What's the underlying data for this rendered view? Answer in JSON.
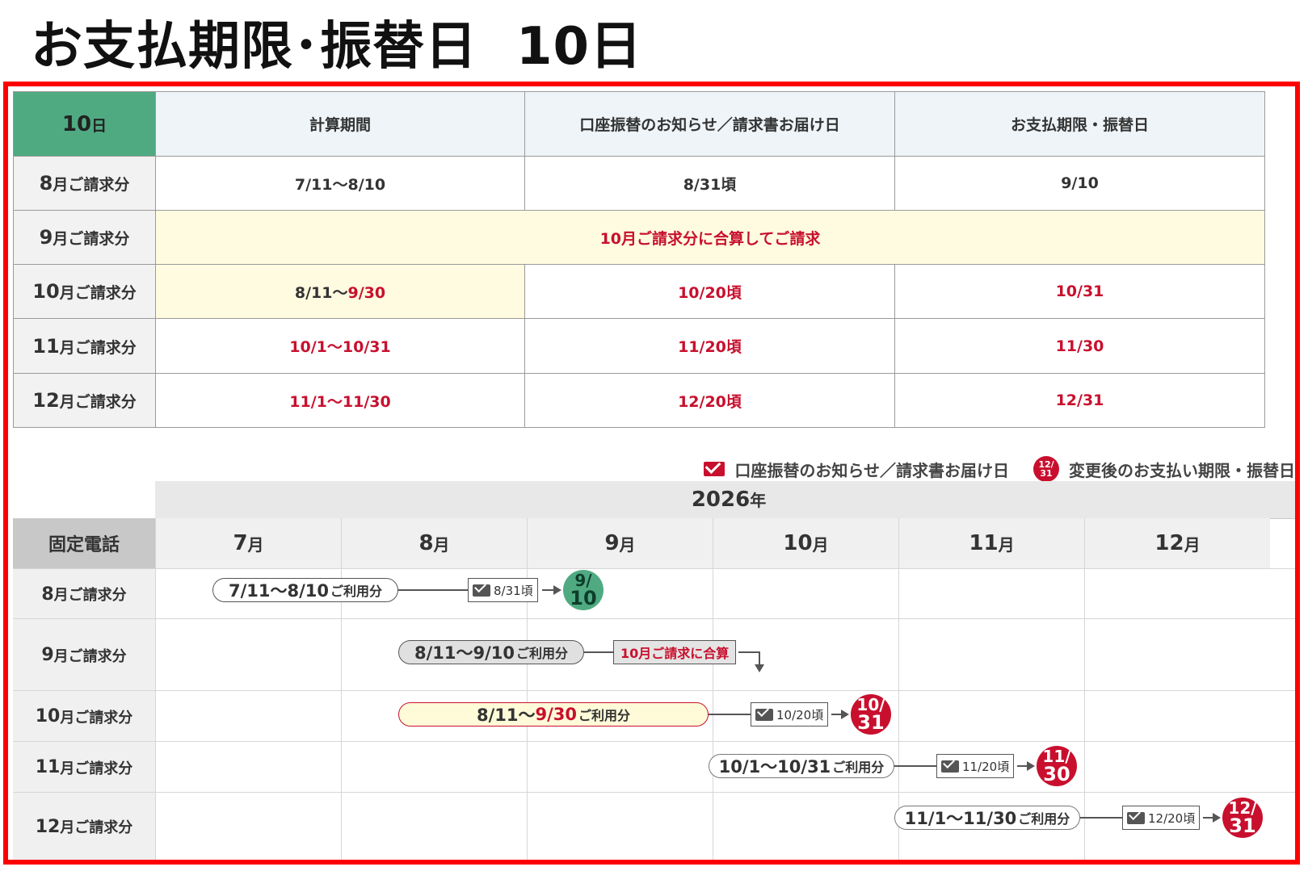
{
  "title": {
    "main": "お支払期限･振替日",
    "sub": "10日"
  },
  "table": {
    "corner": {
      "num": "10",
      "unit": "日"
    },
    "headers": [
      "計算期間",
      "口座振替のお知らせ／請求書お届け日",
      "お支払期限・振替日"
    ],
    "rows": [
      {
        "label_num": "8",
        "label_unit": "月ご請求分",
        "period": "7/11～8/10",
        "notice": "8/31頃",
        "due": "9/10"
      },
      {
        "label_num": "9",
        "label_unit": "月ご請求分",
        "merged": "10月ご請求分に合算してご請求"
      },
      {
        "label_num": "10",
        "label_unit": "月ご請求分",
        "period_a": "8/11～",
        "period_b": "9/30",
        "notice": "10/20頃",
        "due": "10/31"
      },
      {
        "label_num": "11",
        "label_unit": "月ご請求分",
        "period": "10/1～10/31",
        "notice": "11/20頃",
        "due": "11/30"
      },
      {
        "label_num": "12",
        "label_unit": "月ご請求分",
        "period": "11/1～11/30",
        "notice": "12/20頃",
        "due": "12/31"
      }
    ]
  },
  "legend": {
    "notice": "口座振替のお知らせ／請求書お届け日",
    "badge_top": "12/",
    "badge_bot": "31",
    "due": "変更後のお支払い期限・振替日"
  },
  "gantt": {
    "year_num": "2026",
    "year_unit": "年",
    "corner": "固定電話",
    "months": [
      {
        "num": "7",
        "unit": "月"
      },
      {
        "num": "8",
        "unit": "月"
      },
      {
        "num": "9",
        "unit": "月"
      },
      {
        "num": "10",
        "unit": "月"
      },
      {
        "num": "11",
        "unit": "月"
      },
      {
        "num": "12",
        "unit": "月"
      }
    ],
    "usage_suffix": "ご利用分",
    "rows": [
      {
        "label_num": "8",
        "label_unit": "月ご請求分",
        "pill": "7/11～8/10",
        "notice": "8/31頃",
        "badge_top": "9/",
        "badge_bot": "10"
      },
      {
        "label_num": "9",
        "label_unit": "月ご請求分",
        "pill": "8/11～9/10",
        "box": "10月ご請求に合算"
      },
      {
        "label_num": "10",
        "label_unit": "月ご請求分",
        "pill_a": "8/11～",
        "pill_b": "9/30",
        "notice": "10/20頃",
        "badge_top": "10/",
        "badge_bot": "31"
      },
      {
        "label_num": "11",
        "label_unit": "月ご請求分",
        "pill": "10/1～10/31",
        "notice": "11/20頃",
        "badge_top": "11/",
        "badge_bot": "30"
      },
      {
        "label_num": "12",
        "label_unit": "月ご請求分",
        "pill": "11/1～11/30",
        "notice": "12/20頃",
        "badge_top": "12/",
        "badge_bot": "31"
      }
    ]
  },
  "colors": {
    "accent_red": "#c8102e",
    "frame_red": "#ff0000",
    "green": "#4faa82",
    "highlight_yellow": "#fffbe0"
  }
}
